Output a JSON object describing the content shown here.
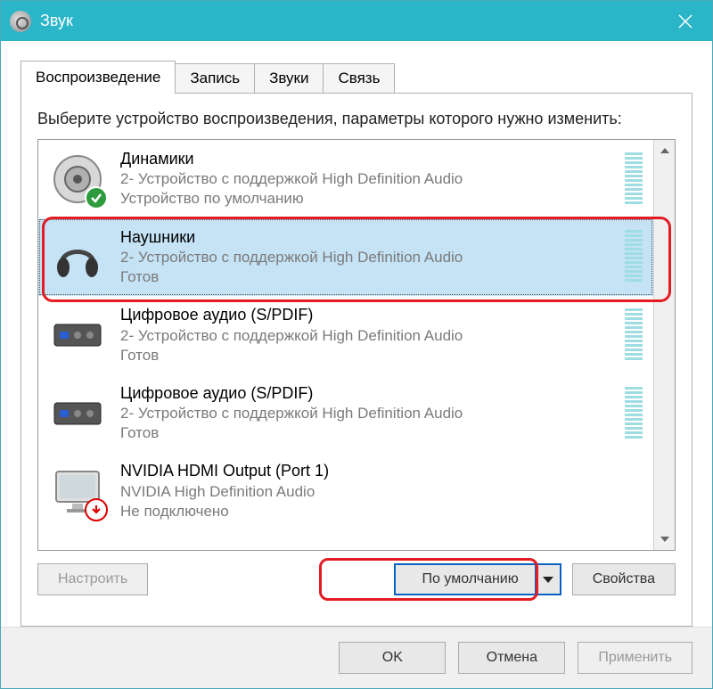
{
  "window": {
    "title": "Звук"
  },
  "tabs": [
    {
      "label": "Воспроизведение",
      "active": true
    },
    {
      "label": "Запись",
      "active": false
    },
    {
      "label": "Звуки",
      "active": false
    },
    {
      "label": "Связь",
      "active": false
    }
  ],
  "instruction": "Выберите устройство воспроизведения, параметры которого нужно изменить:",
  "devices": [
    {
      "title": "Динамики",
      "subtitle": "2- Устройство с поддержкой High Definition Audio",
      "status": "Устройство по умолчанию",
      "icon": "speaker",
      "badge": "check",
      "selected": false
    },
    {
      "title": "Наушники",
      "subtitle": "2- Устройство с поддержкой High Definition Audio",
      "status": "Готов",
      "icon": "headphones",
      "badge": "",
      "selected": true
    },
    {
      "title": "Цифровое аудио (S/PDIF)",
      "subtitle": "2- Устройство с поддержкой High Definition Audio",
      "status": "Готов",
      "icon": "spdif",
      "badge": "",
      "selected": false
    },
    {
      "title": "Цифровое аудио (S/PDIF)",
      "subtitle": "2- Устройство с поддержкой High Definition Audio",
      "status": "Готов",
      "icon": "spdif",
      "badge": "",
      "selected": false
    },
    {
      "title": "NVIDIA HDMI Output (Port 1)",
      "subtitle": "NVIDIA High Definition Audio",
      "status": "Не подключено",
      "icon": "monitor",
      "badge": "down",
      "selected": false
    }
  ],
  "buttons": {
    "configure": "Настроить",
    "set_default": "По умолчанию",
    "properties": "Свойства",
    "ok": "OK",
    "cancel": "Отмена",
    "apply": "Применить"
  }
}
